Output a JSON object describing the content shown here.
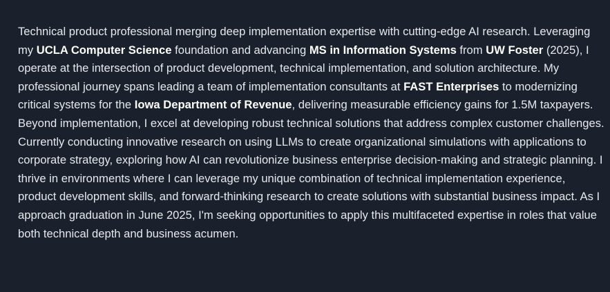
{
  "bio": {
    "segments": [
      {
        "text": "Technical product professional merging deep implementation expertise with cutting-edge AI research. Leveraging my ",
        "bold": false
      },
      {
        "text": "UCLA Computer Science",
        "bold": true
      },
      {
        "text": " foundation and advancing ",
        "bold": false
      },
      {
        "text": "MS in Information Systems",
        "bold": true
      },
      {
        "text": " from ",
        "bold": false
      },
      {
        "text": "UW Foster",
        "bold": true
      },
      {
        "text": " (2025), I operate at the intersection of product development, technical implementation, and solution architecture. My professional journey spans leading a team of implementation consultants at ",
        "bold": false
      },
      {
        "text": "FAST Enterprises",
        "bold": true
      },
      {
        "text": " to modernizing critical systems for the ",
        "bold": false
      },
      {
        "text": "Iowa Department of Revenue",
        "bold": true
      },
      {
        "text": ", delivering measurable efficiency gains for 1.5M taxpayers. Beyond implementation, I excel at developing robust technical solutions that address complex customer challenges. Currently conducting innovative research on using LLMs to create organizational simulations with applications to corporate strategy, exploring how AI can revolutionize business enterprise decision-making and strategic planning. I thrive in environments where I can leverage my unique combination of technical implementation experience, product development skills, and forward-thinking research to create solutions with substantial business impact. As I approach graduation in June 2025, I'm seeking opportunities to apply this multifaceted expertise in roles that value both technical depth and business acumen.",
        "bold": false
      }
    ]
  }
}
